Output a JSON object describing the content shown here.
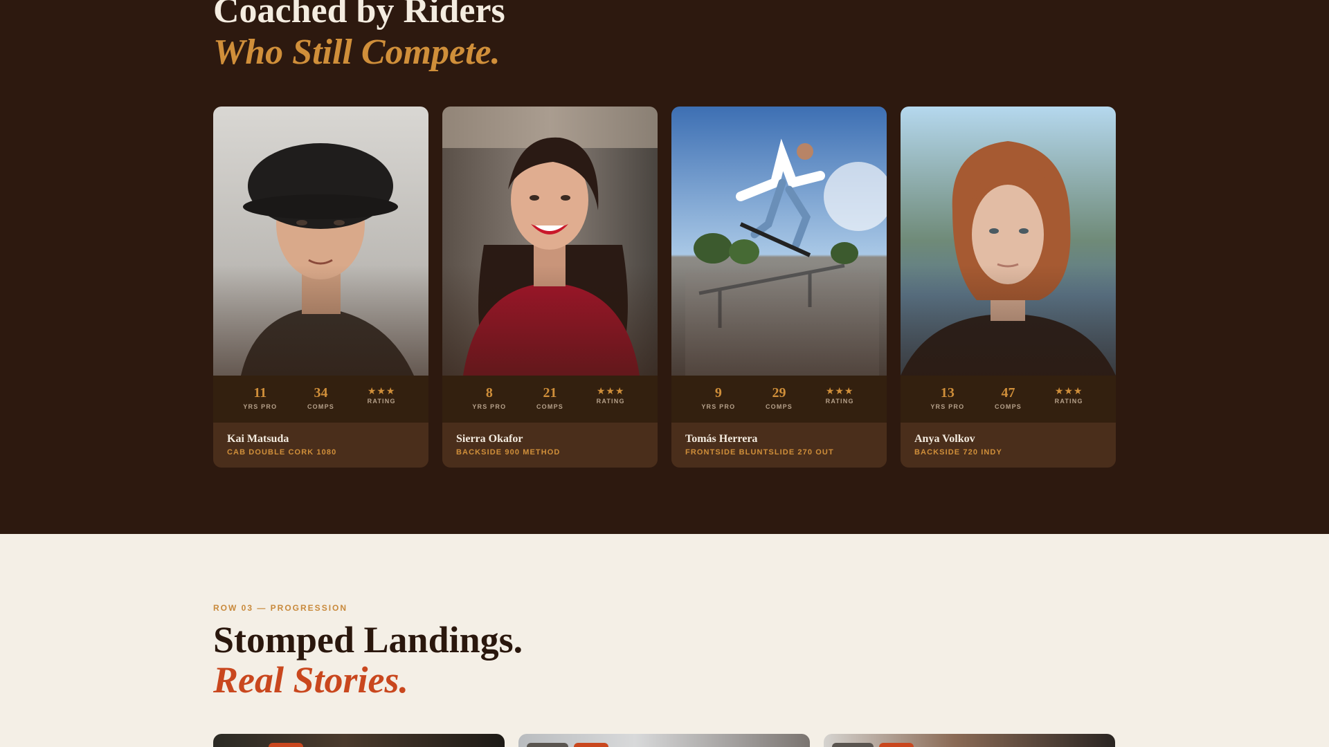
{
  "coaches": {
    "heading_line1": "Coached by Riders",
    "heading_line2": "Who Still Compete.",
    "stat_labels": {
      "years": "YRS PRO",
      "comps": "COMPS",
      "rating": "RATING"
    },
    "cards": [
      {
        "name": "Kai Matsuda",
        "trick": "CAB DOUBLE CORK 1080",
        "years": "11",
        "comps": "34",
        "rating": "★★★"
      },
      {
        "name": "Sierra Okafor",
        "trick": "BACKSIDE 900 METHOD",
        "years": "8",
        "comps": "21",
        "rating": "★★★"
      },
      {
        "name": "Tomás Herrera",
        "trick": "FRONTSIDE BLUNTSLIDE 270 OUT",
        "years": "9",
        "comps": "29",
        "rating": "★★★"
      },
      {
        "name": "Anya Volkov",
        "trick": "BACKSIDE 720 INDY",
        "years": "13",
        "comps": "47",
        "rating": "★★★"
      }
    ]
  },
  "stories": {
    "eyebrow": "ROW 03 — PROGRESSION",
    "heading_line1": "Stomped Landings.",
    "heading_line2": "Real Stories."
  },
  "colors": {
    "dark_bg": "#2d190f",
    "light_bg": "#f4efe6",
    "gold_accent": "#d08f3a",
    "rust_accent": "#c9471e"
  }
}
